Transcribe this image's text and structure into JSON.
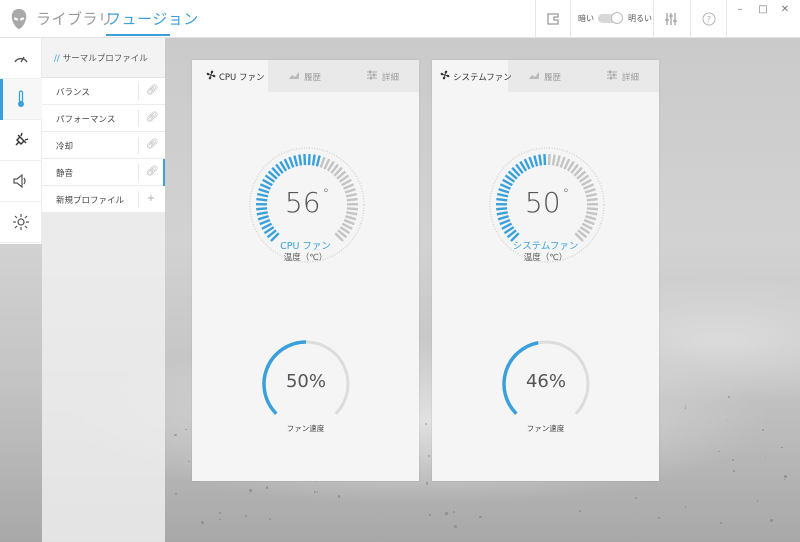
{
  "app": {
    "nav_tabs": [
      {
        "label": "ライブラリ",
        "active": false
      },
      {
        "label": "フュージョン",
        "active": true
      }
    ],
    "toolbar": {
      "brightness_dark_label": "暗い",
      "brightness_light_label": "明るい",
      "icons": [
        "gamepad-icon",
        "equalizer-icon",
        "help-icon"
      ]
    },
    "window_controls": [
      "minimize",
      "maximize",
      "close"
    ],
    "accent_color": "#3aa0db"
  },
  "rail": {
    "items": [
      {
        "icon": "speedometer-icon",
        "active": false
      },
      {
        "icon": "thermometer-icon",
        "active": true
      },
      {
        "icon": "power-plug-icon",
        "active": false
      },
      {
        "icon": "speaker-icon",
        "active": false
      },
      {
        "icon": "lighting-icon",
        "active": false
      }
    ]
  },
  "profiles": {
    "title_prefix": "//",
    "title": "サーマルプロファイル",
    "items": [
      {
        "label": "バランス",
        "icon": "link-icon",
        "active": false
      },
      {
        "label": "パフォーマンス",
        "icon": "link-icon",
        "active": false
      },
      {
        "label": "冷却",
        "icon": "link-icon",
        "active": false
      },
      {
        "label": "静音",
        "icon": "link-icon",
        "active": true
      },
      {
        "label": "新規プロファイル",
        "icon": "plus-icon",
        "active": false
      }
    ]
  },
  "panels": [
    {
      "tabs": [
        {
          "label": "CPU ファン",
          "icon": "fan-icon",
          "active": true
        },
        {
          "label": "履歴",
          "icon": "history-chart-icon",
          "active": false
        },
        {
          "label": "詳細",
          "icon": "sliders-icon",
          "active": false
        }
      ],
      "temperature": "56",
      "degree": "°",
      "temp_max": 100,
      "name": "CPU ファン",
      "unit_label": "温度（℃）",
      "fan_speed": "50%",
      "fan_fraction": 0.5,
      "speed_label": "ファン速度"
    },
    {
      "tabs": [
        {
          "label": "システムファン",
          "icon": "fan-icon",
          "active": true
        },
        {
          "label": "履歴",
          "icon": "history-chart-icon",
          "active": false
        },
        {
          "label": "詳細",
          "icon": "sliders-icon",
          "active": false
        }
      ],
      "temperature": "50",
      "degree": "°",
      "temp_max": 100,
      "name": "システムファン",
      "unit_label": "温度（℃）",
      "fan_speed": "46%",
      "fan_fraction": 0.46,
      "speed_label": "ファン速度"
    }
  ]
}
